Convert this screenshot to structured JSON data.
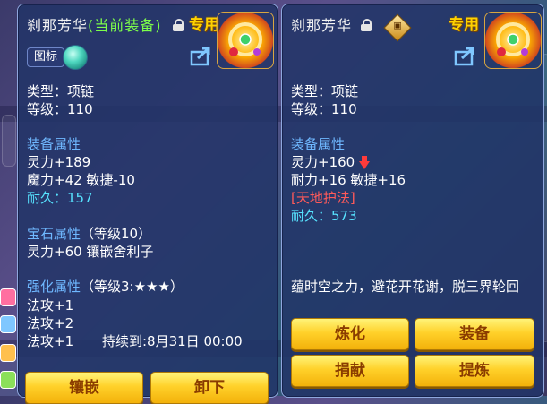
{
  "left_panel": {
    "name": "刹那芳华",
    "equipped_label": "(当前装备)",
    "exclusive": "专用",
    "icon_tag": "图标",
    "type": "类型：项链",
    "level": "等级：110",
    "equip_header": "装备属性",
    "equip_stats": [
      "灵力+189",
      "魔力+42 敏捷-10"
    ],
    "durability": "耐久：157",
    "gem_header": "宝石属性",
    "gem_level": "（等级10）",
    "gem_stats": "灵力+60 镶嵌舍利子",
    "enhance_header": "强化属性",
    "enhance_level": "（等级3:★★★）",
    "enhance_stats": [
      "法攻+1",
      "法攻+2",
      "法攻+1"
    ],
    "duration": "持续到:8月31日 00:00",
    "buttons": {
      "inlay": "镶嵌",
      "unequip": "卸下"
    }
  },
  "right_panel": {
    "name": "刹那芳华",
    "exclusive": "专用",
    "type": "类型：项链",
    "level": "等级：110",
    "equip_header": "装备属性",
    "stat1": "灵力+160",
    "stat2": "耐力+16 敏捷+16",
    "special": "[天地护法]",
    "durability": "耐久：573",
    "description": "蕴时空之力，避花开花谢，脱三界轮回",
    "buttons": {
      "refine": "炼化",
      "equip": "装备",
      "donate": "捐献",
      "extract": "提炼"
    }
  },
  "colors": {
    "accent_yellow": "#ffd200",
    "stat_header_blue": "#6fb8ff",
    "durability_cyan": "#57e3ff",
    "special_red": "#ff5a5a",
    "equipped_green": "#7dff4a"
  }
}
